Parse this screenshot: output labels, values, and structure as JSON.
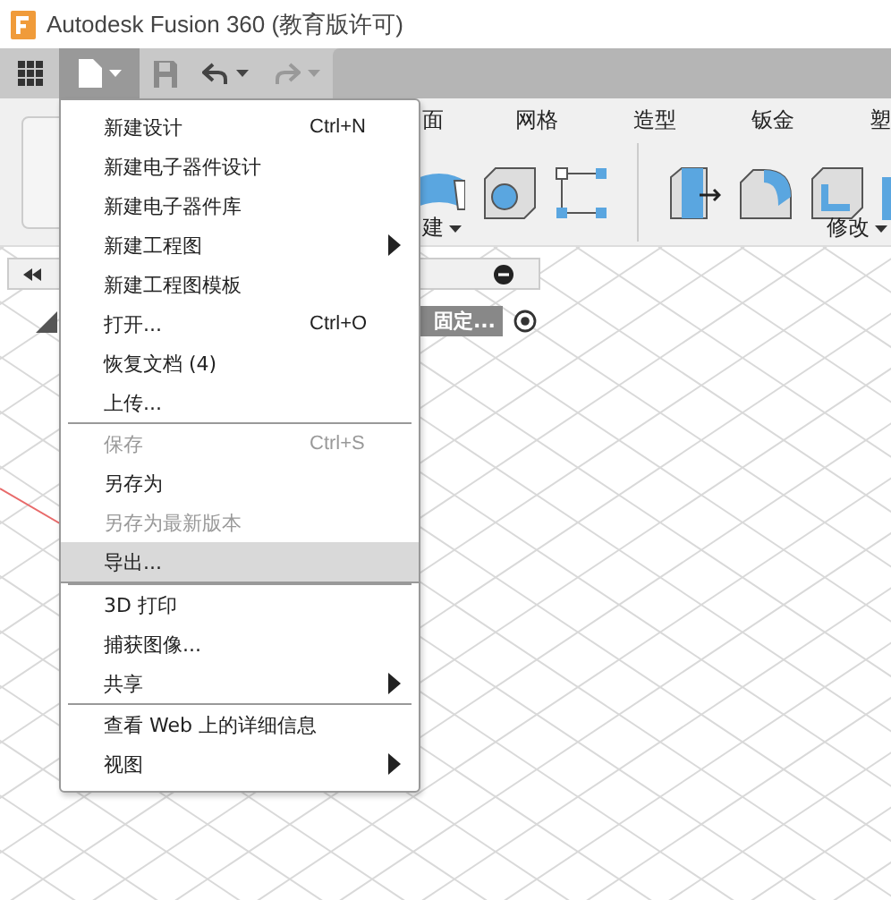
{
  "window": {
    "title": "Autodesk Fusion 360 (教育版许可)"
  },
  "toolbar": {
    "file_menu_open": true
  },
  "ribbon": {
    "tabs": [
      {
        "label": "面"
      },
      {
        "label": "网格"
      },
      {
        "label": "造型"
      },
      {
        "label": "钣金"
      },
      {
        "label": "塑"
      }
    ],
    "groups": [
      {
        "label": "建"
      },
      {
        "label": "修改"
      }
    ]
  },
  "browser": {
    "node_label": "固定..."
  },
  "menu": [
    {
      "kind": "item",
      "label": "新建设计",
      "shortcut": "Ctrl+N",
      "submenu": false,
      "disabled": false,
      "selected": false
    },
    {
      "kind": "item",
      "label": "新建电子器件设计",
      "submenu": false,
      "disabled": false,
      "selected": false
    },
    {
      "kind": "item",
      "label": "新建电子器件库",
      "submenu": false,
      "disabled": false,
      "selected": false
    },
    {
      "kind": "item",
      "label": "新建工程图",
      "submenu": true,
      "disabled": false,
      "selected": false
    },
    {
      "kind": "item",
      "label": "新建工程图模板",
      "submenu": false,
      "disabled": false,
      "selected": false
    },
    {
      "kind": "item",
      "label": "打开...",
      "shortcut": "Ctrl+O",
      "submenu": false,
      "disabled": false,
      "selected": false
    },
    {
      "kind": "item",
      "label": "恢复文档 (4)",
      "submenu": false,
      "disabled": false,
      "selected": false
    },
    {
      "kind": "item",
      "label": "上传...",
      "submenu": false,
      "disabled": false,
      "selected": false
    },
    {
      "kind": "separator"
    },
    {
      "kind": "item",
      "label": "保存",
      "shortcut": "Ctrl+S",
      "submenu": false,
      "disabled": true,
      "selected": false
    },
    {
      "kind": "item",
      "label": "另存为",
      "submenu": false,
      "disabled": false,
      "selected": false
    },
    {
      "kind": "item",
      "label": "另存为最新版本",
      "submenu": false,
      "disabled": true,
      "selected": false
    },
    {
      "kind": "item",
      "label": "导出...",
      "submenu": false,
      "disabled": false,
      "selected": true
    },
    {
      "kind": "separator"
    },
    {
      "kind": "item",
      "label": "3D 打印",
      "submenu": false,
      "disabled": false,
      "selected": false
    },
    {
      "kind": "item",
      "label": "捕获图像...",
      "submenu": false,
      "disabled": false,
      "selected": false
    },
    {
      "kind": "item",
      "label": "共享",
      "submenu": true,
      "disabled": false,
      "selected": false
    },
    {
      "kind": "separator"
    },
    {
      "kind": "item",
      "label": "查看 Web 上的详细信息",
      "submenu": false,
      "disabled": false,
      "selected": false
    },
    {
      "kind": "item",
      "label": "视图",
      "submenu": true,
      "disabled": false,
      "selected": false
    }
  ]
}
